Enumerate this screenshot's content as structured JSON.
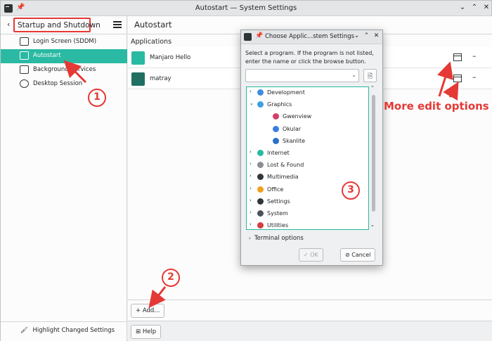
{
  "window": {
    "title": "Autostart — System Settings",
    "controls": {
      "minimize": "⌄",
      "maximize": "⌃",
      "close": "✕"
    }
  },
  "sidebar": {
    "title": "Startup and Shutdown",
    "items": [
      {
        "label": "Login Screen (SDDM)",
        "icon": "login-screen-icon"
      },
      {
        "label": "Autostart",
        "icon": "autostart-icon",
        "active": true
      },
      {
        "label": "Background Services",
        "icon": "services-icon"
      },
      {
        "label": "Desktop Session",
        "icon": "session-icon"
      }
    ],
    "footer_button": "Highlight Changed Settings"
  },
  "main": {
    "title": "Autostart",
    "section": "Applications",
    "apps": [
      {
        "name": "Manjaro Hello",
        "icon_color": "#2ab9a2"
      },
      {
        "name": "matray",
        "icon_color": "#1f6f63"
      }
    ],
    "add_button": "Add...",
    "help_button": "Help"
  },
  "dialog": {
    "title": "Choose Applic...stem Settings",
    "description": "Select a program. If the program is not listed, enter the name or click the browse button.",
    "input_value": "",
    "categories": [
      {
        "label": "Development",
        "arrow": "›",
        "icon_color": "#3d8de0",
        "indent": 0
      },
      {
        "label": "Graphics",
        "arrow": "⌄",
        "icon_color": "#3da0e0",
        "indent": 0
      },
      {
        "label": "Gwenview",
        "arrow": "",
        "icon_color": "#d23f6a",
        "indent": 1
      },
      {
        "label": "Okular",
        "arrow": "",
        "icon_color": "#3d7de0",
        "indent": 1
      },
      {
        "label": "Skanlite",
        "arrow": "",
        "icon_color": "#2a6fc9",
        "indent": 1
      },
      {
        "label": "Internet",
        "arrow": "›",
        "icon_color": "#2ab9a2",
        "indent": 0
      },
      {
        "label": "Lost & Found",
        "arrow": "›",
        "icon_color": "#8a8e92",
        "indent": 0
      },
      {
        "label": "Multimedia",
        "arrow": "›",
        "icon_color": "#31363b",
        "indent": 0
      },
      {
        "label": "Office",
        "arrow": "›",
        "icon_color": "#f0a020",
        "indent": 0
      },
      {
        "label": "Settings",
        "arrow": "›",
        "icon_color": "#31363b",
        "indent": 0
      },
      {
        "label": "System",
        "arrow": "›",
        "icon_color": "#4a5460",
        "indent": 0
      },
      {
        "label": "Utilities",
        "arrow": "›",
        "icon_color": "#d23f3f",
        "indent": 0
      }
    ],
    "terminal_options": "Terminal options",
    "ok_button": "OK",
    "cancel_button": "Cancel"
  },
  "annotations": {
    "step1": "1",
    "step2": "2",
    "step3": "3",
    "more_edit_options": "More edit options",
    "color": "#e53935"
  }
}
